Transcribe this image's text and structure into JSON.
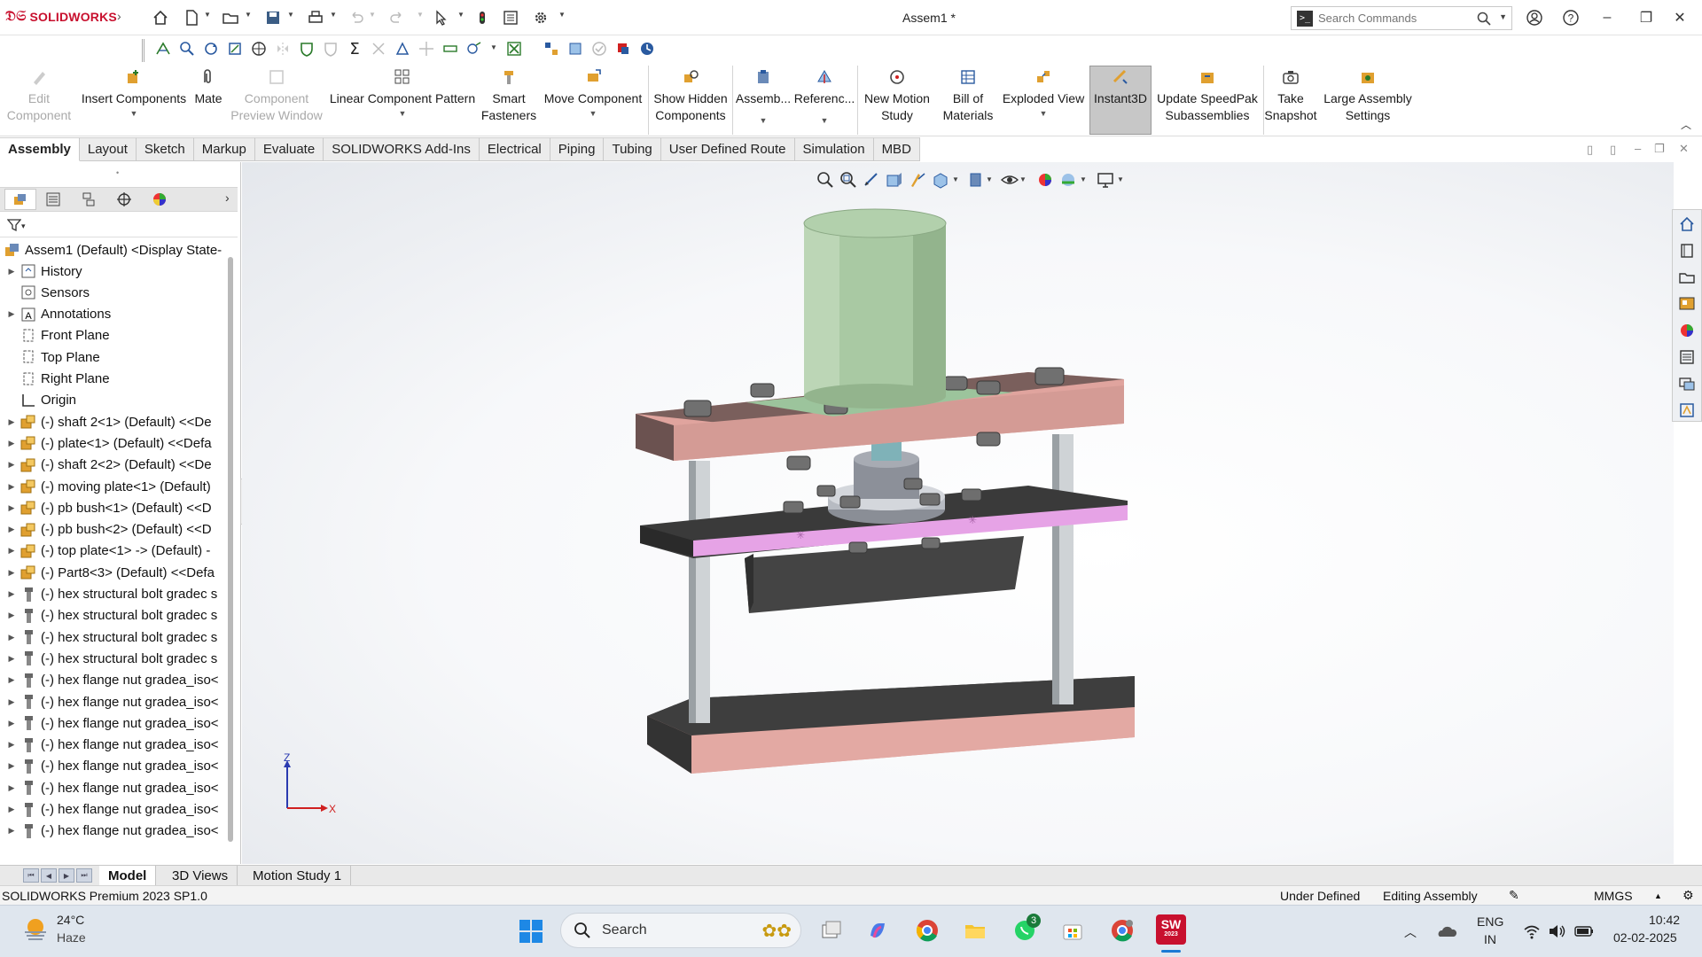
{
  "app": {
    "brand": "SOLIDWORKS",
    "document_title": "Assem1 *"
  },
  "search": {
    "placeholder": "Search Commands"
  },
  "ribbon": {
    "items": [
      {
        "label": "Edit\nComponent",
        "disabled": true
      },
      {
        "label": "Insert Components",
        "caret": true
      },
      {
        "label": "Mate"
      },
      {
        "label": "Component\nPreview Window",
        "disabled": true
      },
      {
        "label": "Linear Component Pattern",
        "caret": true
      },
      {
        "label": "Smart\nFasteners"
      },
      {
        "label": "Move Component",
        "caret": true
      },
      {
        "label": "Show Hidden\nComponents"
      },
      {
        "label": "Assemb...",
        "caret": true
      },
      {
        "label": "Referenc...",
        "caret": true
      },
      {
        "label": "New Motion\nStudy"
      },
      {
        "label": "Bill of\nMaterials"
      },
      {
        "label": "Exploded View",
        "caret": true
      },
      {
        "label": "Instant3D",
        "active": true
      },
      {
        "label": "Update SpeedPak\nSubassemblies"
      },
      {
        "label": "Take\nSnapshot"
      },
      {
        "label": "Large Assembly\nSettings"
      }
    ]
  },
  "tabs": [
    "Assembly",
    "Layout",
    "Sketch",
    "Markup",
    "Evaluate",
    "SOLIDWORKS Add-Ins",
    "Electrical",
    "Piping",
    "Tubing",
    "User Defined Route",
    "Simulation",
    "MBD"
  ],
  "active_tab": "Assembly",
  "tree": {
    "root": "Assem1 (Default) <Display State-",
    "items": [
      {
        "label": "History",
        "icon": "history-icon",
        "expand": true
      },
      {
        "label": "Sensors",
        "icon": "sensor-icon",
        "expand": false
      },
      {
        "label": "Annotations",
        "icon": "annotation-icon",
        "expand": true
      },
      {
        "label": "Front Plane",
        "icon": "plane-icon",
        "expand": false
      },
      {
        "label": "Top Plane",
        "icon": "plane-icon",
        "expand": false
      },
      {
        "label": "Right Plane",
        "icon": "plane-icon",
        "expand": false
      },
      {
        "label": "Origin",
        "icon": "origin-icon",
        "expand": false
      },
      {
        "label": "(-) shaft 2<1> (Default) <<De",
        "icon": "part-icon",
        "expand": true
      },
      {
        "label": "(-) plate<1> (Default) <<Defa",
        "icon": "part-icon",
        "expand": true
      },
      {
        "label": "(-) shaft 2<2> (Default) <<De",
        "icon": "part-icon",
        "expand": true
      },
      {
        "label": "(-) moving plate<1> (Default)",
        "icon": "part-icon",
        "expand": true
      },
      {
        "label": "(-) pb bush<1> (Default) <<D",
        "icon": "part-icon",
        "expand": true
      },
      {
        "label": "(-) pb bush<2> (Default) <<D",
        "icon": "part-icon",
        "expand": true
      },
      {
        "label": "(-) top plate<1> -> (Default) -",
        "icon": "part-icon",
        "expand": true
      },
      {
        "label": "(-) Part8<3> (Default) <<Defa",
        "icon": "part-icon",
        "expand": true
      },
      {
        "label": "(-) hex structural bolt gradec s",
        "icon": "bolt-icon",
        "expand": true
      },
      {
        "label": "(-) hex structural bolt gradec s",
        "icon": "bolt-icon",
        "expand": true
      },
      {
        "label": "(-) hex structural bolt gradec s",
        "icon": "bolt-icon",
        "expand": true
      },
      {
        "label": "(-) hex structural bolt gradec s",
        "icon": "bolt-icon",
        "expand": true
      },
      {
        "label": "(-) hex flange nut gradea_iso<",
        "icon": "bolt-icon",
        "expand": true
      },
      {
        "label": "(-) hex flange nut gradea_iso<",
        "icon": "bolt-icon",
        "expand": true
      },
      {
        "label": "(-) hex flange nut gradea_iso<",
        "icon": "bolt-icon",
        "expand": true
      },
      {
        "label": "(-) hex flange nut gradea_iso<",
        "icon": "bolt-icon",
        "expand": true
      },
      {
        "label": "(-) hex flange nut gradea_iso<",
        "icon": "bolt-icon",
        "expand": true
      },
      {
        "label": "(-) hex flange nut gradea_iso<",
        "icon": "bolt-icon",
        "expand": true
      },
      {
        "label": "(-) hex flange nut gradea_iso<",
        "icon": "bolt-icon",
        "expand": true
      },
      {
        "label": "(-) hex flange nut gradea_iso<",
        "icon": "bolt-icon",
        "expand": true
      }
    ]
  },
  "triad": {
    "z": "Z",
    "x": "X"
  },
  "bottom_tabs": [
    "Model",
    "3D Views",
    "Motion Study 1"
  ],
  "active_bottom_tab": "Model",
  "status": {
    "product": "SOLIDWORKS Premium 2023 SP1.0",
    "definition": "Under Defined",
    "mode": "Editing Assembly",
    "units": "MMGS"
  },
  "taskbar": {
    "weather_temp": "24°C",
    "weather_desc": "Haze",
    "search_label": "Search",
    "whatsapp_badge": "3",
    "lang": "ENG",
    "region": "IN",
    "time": "10:42",
    "date": "02-02-2025",
    "sw_badge": "2023"
  },
  "colors": {
    "accent_red": "#c8102e",
    "cylinder_green": "#a9c9a3",
    "plate_pink": "#e0a49e",
    "moving_plate_magenta": "#e6a3e6",
    "plate_dark": "#4a4a4a"
  }
}
